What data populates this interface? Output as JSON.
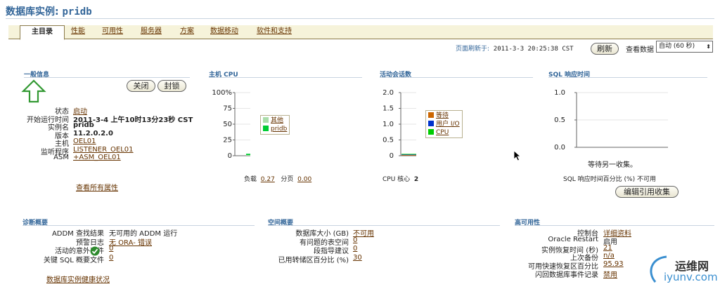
{
  "header": {
    "title_prefix": "数据库实例:",
    "title_db": "pridb"
  },
  "tabs": [
    {
      "label": "主目录"
    },
    {
      "label": "性能"
    },
    {
      "label": "可用性"
    },
    {
      "label": "服务器"
    },
    {
      "label": "方案"
    },
    {
      "label": "数据移动"
    },
    {
      "label": "软件和支持"
    }
  ],
  "refresh": {
    "label": "页面刷新于:",
    "timestamp": "2011-3-3 20:25:38 CST",
    "refresh_button": "刷新",
    "view_data_label": "查看数据",
    "view_data_value": "自动 (60 秒)"
  },
  "general": {
    "title": "一般信息",
    "shutdown_button": "关闭",
    "blackout_button": "封锁",
    "fields": [
      {
        "label": "状态",
        "value": "启动",
        "link": true
      },
      {
        "label": "开始运行时间",
        "value": "2011-3-4 上午10时13分23秒 CST",
        "bold": true
      },
      {
        "label": "实例名",
        "value": "pridb",
        "bold": true
      },
      {
        "label": "版本",
        "value": "11.2.0.2.0",
        "bold": true
      },
      {
        "label": "主机",
        "value": "OEL01",
        "link": true
      },
      {
        "label": "监听程序",
        "value": "LISTENER_OEL01",
        "link": true
      },
      {
        "label": "ASM",
        "value": "+ASM_OEL01",
        "link": true
      }
    ],
    "view_all_link": "查看所有属性",
    "status_color": "#339933"
  },
  "host_cpu": {
    "title": "主机 CPU",
    "load_label": "负载",
    "load_value": "0.27",
    "paging_label": "分页",
    "paging_value": "0.00"
  },
  "active_sessions": {
    "title": "活动会话数",
    "cpu_cores_label": "CPU 核心",
    "cpu_cores_value": "2"
  },
  "sql_response": {
    "title": "SQL 响应时间",
    "waiting_text": "等待另一收集。",
    "percent_label": "SQL 响应时间百分比 (%)",
    "percent_value": "不可用",
    "edit_button": "编辑引用收集"
  },
  "chart_data": [
    {
      "type": "bar",
      "title": "主机 CPU",
      "yticks": [
        "100%",
        "75",
        "50",
        "25",
        "0"
      ],
      "ylim": [
        0,
        100
      ],
      "categories": [
        "current"
      ],
      "series": [
        {
          "name": "其他",
          "values": [
            1
          ],
          "color": "#aaddaa"
        },
        {
          "name": "pridb",
          "values": [
            2
          ],
          "color": "#00cc33"
        }
      ]
    },
    {
      "type": "area",
      "title": "活动会话数",
      "yticks": [
        "2.0",
        "1.5",
        "1.0",
        "0.5",
        "0"
      ],
      "ylim": [
        0,
        2.0
      ],
      "series": [
        {
          "name": "等待",
          "values": [
            0.02
          ],
          "color": "#cc6600"
        },
        {
          "name": "用户 I/O",
          "values": [
            0.01
          ],
          "color": "#0033cc"
        },
        {
          "name": "CPU",
          "values": [
            0.02
          ],
          "color": "#00cc00"
        }
      ]
    },
    {
      "type": "line",
      "title": "SQL 响应时间",
      "yticks": [
        "1.0",
        "0.5",
        "0.0"
      ],
      "ylim": [
        0,
        1.0
      ],
      "series": []
    }
  ],
  "diagnostics": {
    "title": "诊断概要",
    "fields": [
      {
        "label": "ADDM 查找结果",
        "value": "无可用的 ADDM 运行"
      },
      {
        "label": "预警日志",
        "value": "无 ORA- 错误",
        "link": true
      },
      {
        "label": "活动的意外事件",
        "value": "0",
        "link": true
      },
      {
        "label": "关键 SQL 概要文件",
        "value": "0",
        "link": true
      }
    ],
    "health_link": "数据库实例健康状况"
  },
  "space": {
    "title": "空间概要",
    "fields": [
      {
        "label": "数据库大小 (GB)",
        "value": "不可用",
        "link": true
      },
      {
        "label": "有问题的表空间",
        "value": "0",
        "link": true
      },
      {
        "label": "段指导建议",
        "value": "0",
        "link": true
      },
      {
        "label": "已用转储区百分比 (%)",
        "value": "30",
        "link": true
      }
    ]
  },
  "ha": {
    "title": "高可用性",
    "fields": [
      {
        "label": "控制台",
        "value": "详细资料",
        "link": true
      },
      {
        "label": "Oracle Restart",
        "value": "启用"
      },
      {
        "label": "实例恢复时间 (秒)",
        "value": "21",
        "link": true
      },
      {
        "label": "上次备份",
        "value": "n/a",
        "link": true
      },
      {
        "label": "可用快速恢复区百分比",
        "value": "95.93",
        "link": true
      },
      {
        "label": "闪回数据库事件记录",
        "value": "禁用",
        "link": true
      }
    ]
  },
  "watermark": {
    "cn": "运维网",
    "en": "iyunv.com"
  }
}
